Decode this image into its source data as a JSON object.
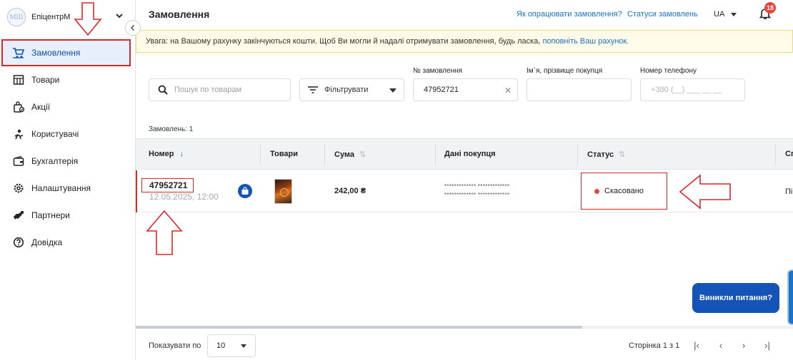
{
  "sidebar": {
    "avatar_text": "МШ",
    "store_name": "ЕпіцентрМ",
    "items": [
      {
        "label": "Замовлення",
        "icon": "cart-icon"
      },
      {
        "label": "Товари",
        "icon": "store-icon"
      },
      {
        "label": "Акції",
        "icon": "gift-icon"
      },
      {
        "label": "Користувачі",
        "icon": "users-icon"
      },
      {
        "label": "Бухгалтерія",
        "icon": "wallet-icon"
      },
      {
        "label": "Налаштування",
        "icon": "gear-icon"
      },
      {
        "label": "Партнери",
        "icon": "handshake-icon"
      },
      {
        "label": "Довідка",
        "icon": "help-icon"
      }
    ]
  },
  "header": {
    "title": "Замовлення",
    "link_process": "Як опрацювати замовлення?",
    "link_statuses": "Статуси замовлень",
    "language": "UA",
    "notifications": "18"
  },
  "warning": {
    "text": "Увага: на Вашому рахунку закінчуються кошти. Щоб Ви могли й надалі отримувати замовлення, будь ласка, ",
    "link": "поповніть Ваш рахунок."
  },
  "filters": {
    "search_placeholder": "Пошук по товарам",
    "filter_label": "Фільтрувати",
    "order_number_label": "№ замовлення",
    "order_number_value": "47952721",
    "buyer_name_label": "Ім`я, прізвище покупця",
    "buyer_name_value": "",
    "phone_label": "Номер телефону",
    "phone_placeholder": "+380 (__) ___ __ __"
  },
  "orders_count": "Замовлень: 1",
  "table": {
    "columns": [
      "Номер",
      "Товари",
      "Сума",
      "Дані покупця",
      "Статус",
      "Сп"
    ],
    "rows": [
      {
        "number": "47952721",
        "date": "12.05.2025, 12:00",
        "sum": "242,00 ₴",
        "buyer_line1": "************* *************",
        "buyer_line2": "************* *************",
        "status": "Скасовано",
        "extra": "Пі"
      }
    ]
  },
  "help_button": "Виникли питання?",
  "footer": {
    "show_label": "Показувати по",
    "per_page": "10",
    "page_info": "Сторінка 1 з 1"
  },
  "colors": {
    "accent": "#1453b8",
    "link": "#1a73c9",
    "annotation": "#d42a2a",
    "status_cancelled": "#e04848"
  }
}
